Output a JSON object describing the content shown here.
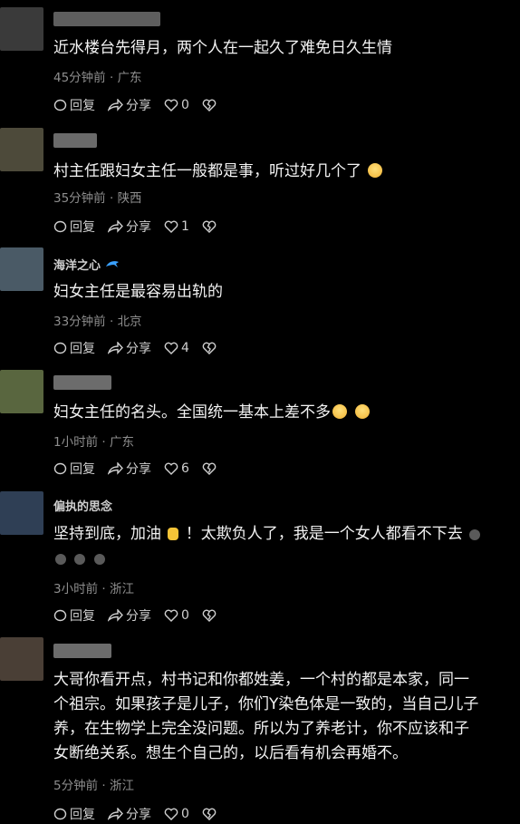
{
  "comments": [
    {
      "text": "近水楼台先得月，两个人在一起久了难免日久生情",
      "time": "45分钟前",
      "location": "广东",
      "reply": "回复",
      "share": "分享",
      "likes": "0",
      "avatar_color": "#3a3a3a"
    },
    {
      "text": "村主任跟妇女主任一般都是事，听过好几个了",
      "time": "35分钟前",
      "location": "陕西",
      "reply": "回复",
      "share": "分享",
      "likes": "1",
      "avatar_color": "#4d4a3a"
    },
    {
      "name": "海洋之心",
      "text": "妇女主任是最容易出轨的",
      "time": "33分钟前",
      "location": "北京",
      "reply": "回复",
      "share": "分享",
      "likes": "4",
      "avatar_color": "#4a5a66"
    },
    {
      "text": "妇女主任的名头。全国统一基本上差不多",
      "time": "1小时前",
      "location": "广东",
      "reply": "回复",
      "share": "分享",
      "likes": "6",
      "avatar_color": "#59663f"
    },
    {
      "name": "偏执的思念",
      "text": "坚持到底，加油",
      "text2": "！太欺负人了，我是一个女人都看不下去",
      "time": "3小时前",
      "location": "浙江",
      "reply": "回复",
      "share": "分享",
      "likes": "0",
      "avatar_color": "#2f3f55"
    },
    {
      "text_lines": [
        "大哥你看开点，村书记和你都姓姜，一个村的都是本家，同一",
        "个祖宗。如果孩子是儿子，你们Y染色体是一致的，当自己儿子",
        "养，在生物学上完全没问题。所以为了养老计，你不应该和子",
        "女断绝关系。想生个自己的，以后看有机会再婚不。"
      ],
      "time": "5分钟前",
      "location": "浙江",
      "reply": "回复",
      "share": "分享",
      "likes": "0",
      "avatar_color": "#4a3f36"
    }
  ],
  "separator": " · "
}
